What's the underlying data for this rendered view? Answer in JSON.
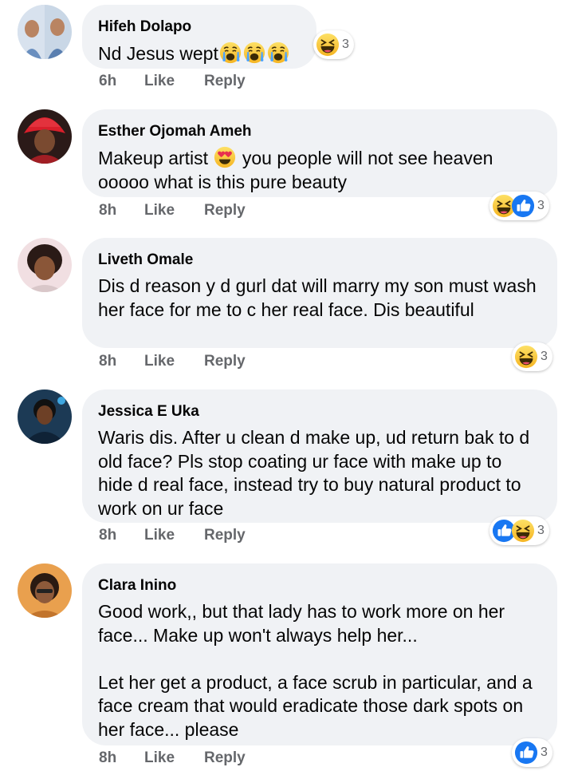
{
  "comments": [
    {
      "author": "Hifeh Dolapo",
      "text": "Nd Jesus wept",
      "time": "6h",
      "like_label": "Like",
      "reply_label": "Reply",
      "reaction_count": "3",
      "reactions": [
        "haha"
      ],
      "inline_emojis": [
        "crying",
        "crying",
        "crying"
      ]
    },
    {
      "author": "Esther Ojomah Ameh",
      "text_before_emoji": "Makeup artist",
      "text_after_emoji": "you people will not see heaven ooooo what is this pure beauty",
      "time": "8h",
      "like_label": "Like",
      "reply_label": "Reply",
      "reaction_count": "3",
      "reactions": [
        "haha",
        "like"
      ],
      "inline_emojis": [
        "heart-eyes"
      ]
    },
    {
      "author": "Liveth Omale",
      "text": "Dis d reason y d gurl dat will marry my son must wash her face for me to c her real face. Dis beautiful",
      "time": "8h",
      "like_label": "Like",
      "reply_label": "Reply",
      "reaction_count": "3",
      "reactions": [
        "haha"
      ]
    },
    {
      "author": "Jessica E Uka",
      "text": "Waris dis. After u clean d make up, ud return bak to d old face? Pls stop coating ur face with make up to hide d real face, instead try to buy natural product to work on ur face",
      "time": "8h",
      "like_label": "Like",
      "reply_label": "Reply",
      "reaction_count": "3",
      "reactions": [
        "like",
        "haha"
      ]
    },
    {
      "author": "Clara Inino",
      "text": "Good work,, but that lady has to work more on her face... Make up won't always help her...\n\nLet her get a product, a face scrub in particular, and a face cream that would eradicate those dark spots on her face... please",
      "time": "8h",
      "like_label": "Like",
      "reply_label": "Reply",
      "reaction_count": "3",
      "reactions": [
        "like"
      ]
    }
  ],
  "colors": {
    "bubble": "#f0f2f5",
    "meta_text": "#65676b",
    "like_blue": "#1877f2",
    "haha_yellow": "#f7b125"
  }
}
